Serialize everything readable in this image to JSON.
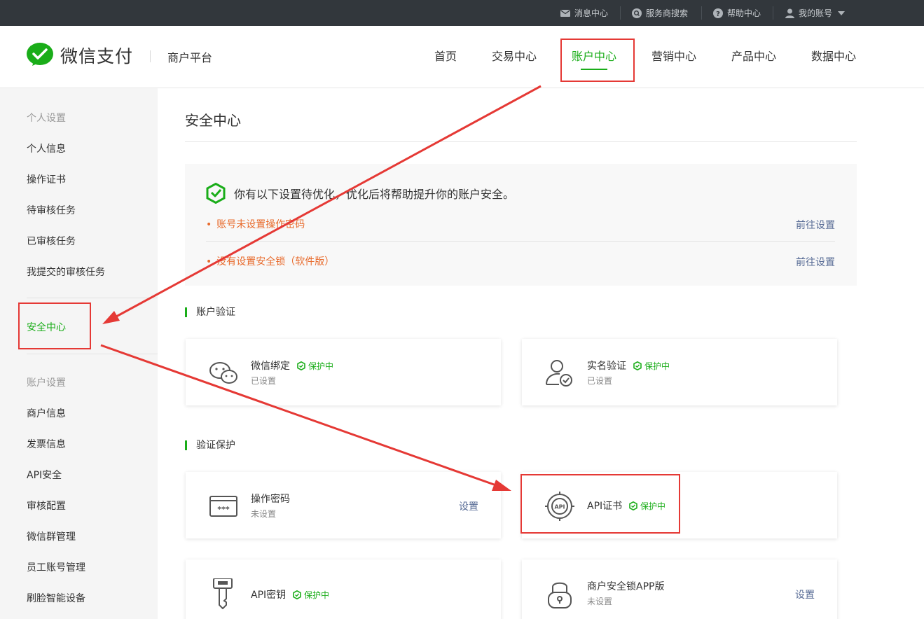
{
  "topbar": {
    "messages": "消息中心",
    "provider_search": "服务商搜索",
    "help": "帮助中心",
    "account": "我的账号"
  },
  "header": {
    "brand": "微信支付",
    "platform": "商户平台",
    "nav": [
      "首页",
      "交易中心",
      "账户中心",
      "营销中心",
      "产品中心",
      "数据中心"
    ],
    "active_nav": "账户中心"
  },
  "sidebar": {
    "group_personal": "个人设置",
    "personal_items": [
      "个人信息",
      "操作证书",
      "待审核任务",
      "已审核任务",
      "我提交的审核任务"
    ],
    "security": "安全中心",
    "group_account": "账户设置",
    "account_items": [
      "商户信息",
      "发票信息",
      "API安全",
      "审核配置",
      "微信群管理",
      "员工账号管理",
      "刷脸智能设备"
    ]
  },
  "main": {
    "title": "安全中心",
    "alert": {
      "message": "你有以下设置待优化，优化后将帮助提升你的账户安全。",
      "items": [
        {
          "text": "账号未设置操作密码",
          "link": "前往设置"
        },
        {
          "text": "没有设置安全锁（软件版）",
          "link": "前往设置"
        }
      ]
    },
    "section_verify": "账户验证",
    "section_protect": "验证保护",
    "cards": {
      "wechat_bind": {
        "name": "微信绑定",
        "badge": "保护中",
        "status": "已设置"
      },
      "real_name": {
        "name": "实名验证",
        "badge": "保护中",
        "status": "已设置"
      },
      "op_password": {
        "name": "操作密码",
        "status": "未设置",
        "action": "设置"
      },
      "api_cert": {
        "name": "API证书",
        "badge": "保护中"
      },
      "api_key": {
        "name": "API密钥",
        "badge": "保护中"
      },
      "lock_app": {
        "name": "商户安全锁APP版",
        "status": "未设置",
        "action": "设置"
      }
    }
  },
  "colors": {
    "brand_green": "#1aad19",
    "warning_orange": "#e86b2d",
    "link_blue": "#576b95",
    "annotation_red": "#e53935",
    "topbar_bg": "#32373c"
  }
}
